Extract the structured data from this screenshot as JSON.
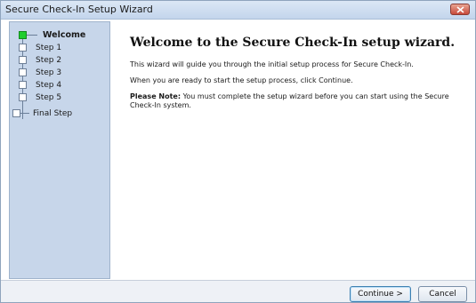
{
  "window": {
    "title": "Secure Check-In Setup Wizard",
    "close_icon": "close-icon"
  },
  "sidebar": {
    "steps": [
      {
        "label": "Welcome",
        "active": true
      },
      {
        "label": "Step 1",
        "active": false
      },
      {
        "label": "Step 2",
        "active": false
      },
      {
        "label": "Step 3",
        "active": false
      },
      {
        "label": "Step 4",
        "active": false
      },
      {
        "label": "Step 5",
        "active": false
      },
      {
        "label": "Final Step",
        "active": false
      }
    ]
  },
  "main": {
    "heading": "Welcome to the Secure Check-In setup wizard.",
    "para1": "This wizard will guide you through the initial setup process for Secure Check-In.",
    "para2": "When you are ready to start the setup process, click Continue.",
    "note_label": "Please Note:",
    "note_text": " You must complete the setup wizard before you can start using the Secure Check-In system."
  },
  "footer": {
    "continue_label": "Continue >",
    "cancel_label": "Cancel"
  },
  "colors": {
    "sidebar_bg": "#c7d6ea",
    "active_step": "#1fce2e",
    "titlebar": "#c3d5ec",
    "close_button": "#c7493a"
  }
}
